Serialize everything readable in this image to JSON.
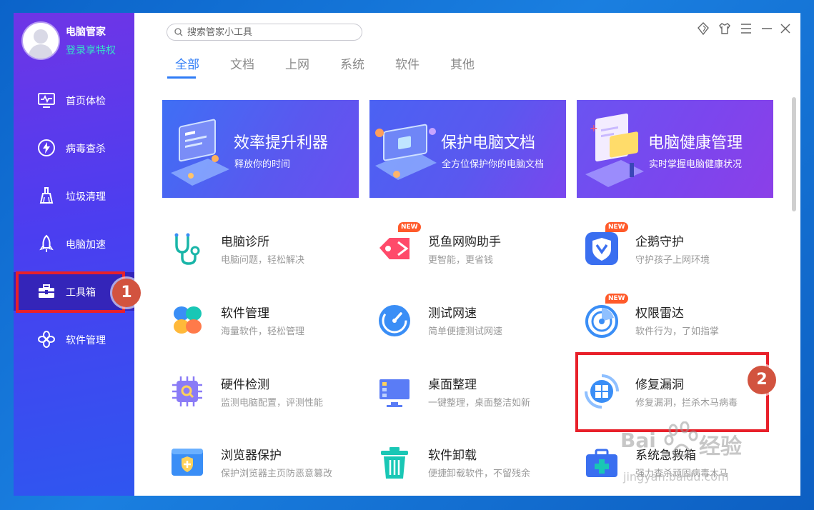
{
  "sidebar": {
    "app_name": "电脑管家",
    "login_text": "登录享特权",
    "items": [
      {
        "label": "首页体检",
        "icon": "monitor-pulse-icon"
      },
      {
        "label": "病毒查杀",
        "icon": "lightning-shield-icon"
      },
      {
        "label": "垃圾清理",
        "icon": "broom-icon"
      },
      {
        "label": "电脑加速",
        "icon": "rocket-icon"
      },
      {
        "label": "工具箱",
        "icon": "toolbox-icon",
        "active": true
      },
      {
        "label": "软件管理",
        "icon": "apps-icon"
      }
    ]
  },
  "search": {
    "placeholder": "搜索管家小工具"
  },
  "window_controls": [
    "skin-icon",
    "shirt-icon",
    "menu-icon",
    "minimize-icon",
    "close-icon"
  ],
  "tabs": [
    {
      "label": "全部",
      "active": true
    },
    {
      "label": "文档"
    },
    {
      "label": "上网"
    },
    {
      "label": "系统"
    },
    {
      "label": "软件"
    },
    {
      "label": "其他"
    }
  ],
  "banners": [
    {
      "title": "效率提升利器",
      "subtitle": "释放你的时间"
    },
    {
      "title": "保护电脑文档",
      "subtitle": "全方位保护你的电脑文档"
    },
    {
      "title": "电脑健康管理",
      "subtitle": "实时掌握电脑健康状况"
    }
  ],
  "tools": [
    {
      "name": "电脑诊所",
      "desc": "电脑问题，轻松解决",
      "icon": "stethoscope-icon"
    },
    {
      "name": "觅鱼网购助手",
      "desc": "更智能，更省钱",
      "icon": "price-tag-icon",
      "badge": "NEW"
    },
    {
      "name": "企鹅守护",
      "desc": "守护孩子上网环境",
      "icon": "guardian-shield-icon",
      "badge": "NEW"
    },
    {
      "name": "软件管理",
      "desc": "海量软件，轻松管理",
      "icon": "clover-icon"
    },
    {
      "name": "测试网速",
      "desc": "简单便捷测试网速",
      "icon": "speedometer-icon"
    },
    {
      "name": "权限雷达",
      "desc": "软件行为，了如指掌",
      "icon": "radar-icon",
      "badge": "NEW"
    },
    {
      "name": "硬件检测",
      "desc": "监测电脑配置，评测性能",
      "icon": "chip-icon"
    },
    {
      "name": "桌面整理",
      "desc": "一键整理，桌面整洁如新",
      "icon": "desktop-icon"
    },
    {
      "name": "修复漏洞",
      "desc": "修复漏洞，拦杀木马病毒",
      "icon": "windows-repair-icon"
    },
    {
      "name": "浏览器保护",
      "desc": "保护浏览器主页防恶意篡改",
      "icon": "browser-shield-icon"
    },
    {
      "name": "软件卸载",
      "desc": "便捷卸载软件，不留残余",
      "icon": "trash-icon"
    },
    {
      "name": "系统急救箱",
      "desc": "强力查杀顽固病毒木马",
      "icon": "first-aid-kit-icon"
    }
  ],
  "annotations": [
    "1",
    "2"
  ],
  "watermark": {
    "brand": "Bai",
    "cn": "经验",
    "url": "jingyan.baidu.com"
  }
}
